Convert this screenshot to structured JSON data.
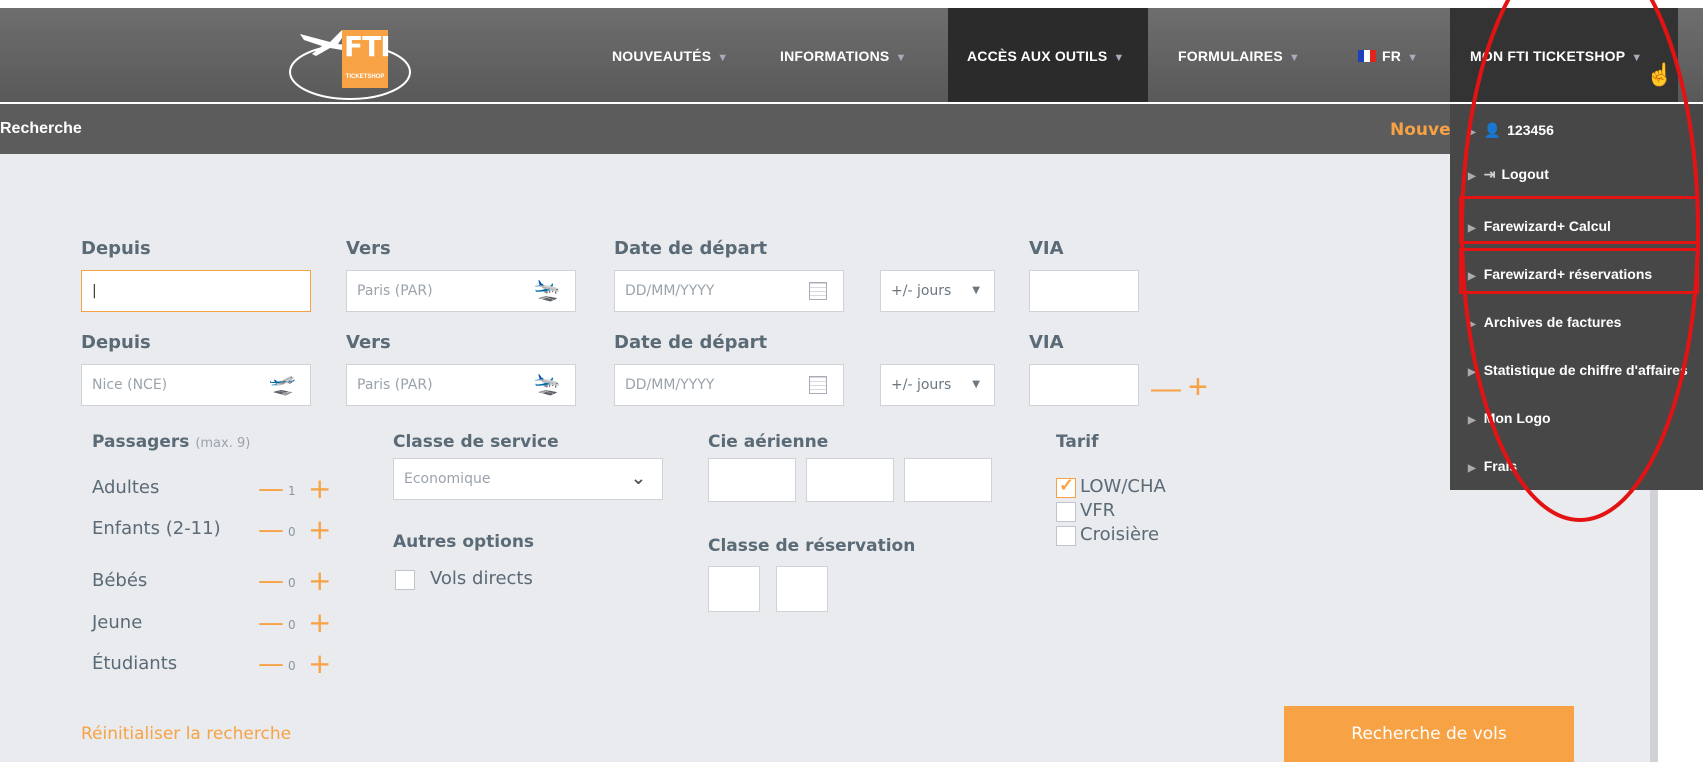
{
  "header": {
    "logo_text": "FTI",
    "logo_sub": "TICKETSHOP",
    "nav": [
      {
        "label": "NOUVEAUTÉS"
      },
      {
        "label": "INFORMATIONS"
      },
      {
        "label": "ACCÈS AUX OUTILS"
      },
      {
        "label": "FORMULAIRES"
      },
      {
        "label": "FR"
      },
      {
        "label": "MON FTI TICKETSHOP"
      }
    ]
  },
  "searchbar": {
    "title": "Recherche",
    "new_search": "Nouvelle recherche"
  },
  "form": {
    "row1": {
      "from_label": "Depuis",
      "from_value": "|",
      "to_label": "Vers",
      "to_placeholder": "Paris (PAR)",
      "date_label": "Date de départ",
      "date_placeholder": "DD/MM/YYYY",
      "days_label": "+/- jours",
      "via_label": "VIA"
    },
    "row2": {
      "from_label": "Depuis",
      "from_placeholder": "Nice (NCE)",
      "to_label": "Vers",
      "to_placeholder": "Paris (PAR)",
      "date_label": "Date de départ",
      "date_placeholder": "DD/MM/YYYY",
      "days_label": "+/- jours",
      "via_label": "VIA"
    },
    "passengers": {
      "title": "Passagers",
      "max": "(max. 9)",
      "rows": [
        {
          "label": "Adultes",
          "value": "1"
        },
        {
          "label": "Enfants (2-11)",
          "value": "0"
        },
        {
          "label": "Bébés",
          "value": "0"
        },
        {
          "label": "Jeune",
          "value": "0"
        },
        {
          "label": "Étudiants",
          "value": "0"
        }
      ]
    },
    "class_label": "Classe de service",
    "class_value": "Economique",
    "other_options": "Autres options",
    "direct_flights": "Vols directs",
    "airline_label": "Cie aérienne",
    "booking_class_label": "Classe de réservation",
    "tarif_label": "Tarif",
    "tarifs": [
      {
        "label": "LOW/CHA",
        "checked": true
      },
      {
        "label": "VFR",
        "checked": false
      },
      {
        "label": "Croisière",
        "checked": false
      }
    ],
    "reset": "Réinitialiser la recherche",
    "search_button": "Recherche de vols"
  },
  "dropdown": {
    "items": [
      {
        "label": "123456"
      },
      {
        "label": "Logout"
      },
      {
        "label": "Farewizard+ Calcul"
      },
      {
        "label": "Farewizard+ réservations"
      },
      {
        "label": "Archives de factures"
      },
      {
        "label": "Statistique de chiffre d'affaires"
      },
      {
        "label": "Mon Logo"
      },
      {
        "label": "Frais"
      }
    ]
  },
  "colors": {
    "accent": "#f7a244",
    "annotation": "#e41313"
  }
}
